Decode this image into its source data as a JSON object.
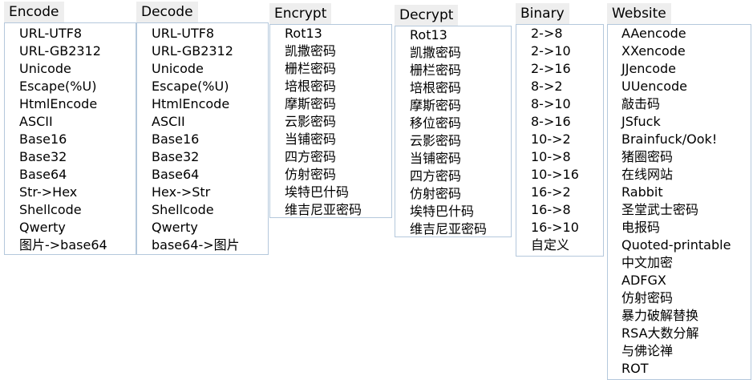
{
  "menus": {
    "encode": {
      "title": "Encode",
      "items": [
        "URL-UTF8",
        "URL-GB2312",
        "Unicode",
        "Escape(%U)",
        "HtmlEncode",
        "ASCII",
        "Base16",
        "Base32",
        "Base64",
        "Str->Hex",
        "Shellcode",
        "Qwerty",
        "图片->base64"
      ]
    },
    "decode": {
      "title": "Decode",
      "items": [
        "URL-UTF8",
        "URL-GB2312",
        "Unicode",
        "Escape(%U)",
        "HtmlEncode",
        "ASCII",
        "Base16",
        "Base32",
        "Base64",
        "Hex->Str",
        "Shellcode",
        "Qwerty",
        "base64->图片"
      ]
    },
    "encrypt": {
      "title": "Encrypt",
      "items": [
        "Rot13",
        "凯撒密码",
        "栅栏密码",
        "培根密码",
        "摩斯密码",
        "云影密码",
        "当铺密码",
        "四方密码",
        "仿射密码",
        "埃特巴什码",
        "维吉尼亚密码"
      ]
    },
    "decrypt": {
      "title": "Decrypt",
      "items": [
        "Rot13",
        "凯撒密码",
        "栅栏密码",
        "培根密码",
        "摩斯密码",
        "移位密码",
        "云影密码",
        "当铺密码",
        "四方密码",
        "仿射密码",
        "埃特巴什码",
        "维吉尼亚密码"
      ]
    },
    "binary": {
      "title": "Binary",
      "items": [
        "2->8",
        "2->10",
        "2->16",
        "8->2",
        "8->10",
        "8->16",
        "10->2",
        "10->8",
        "10->16",
        "16->2",
        "16->8",
        "16->10",
        "自定义"
      ]
    },
    "website": {
      "title": "Website",
      "items": [
        "AAencode",
        "XXencode",
        "JJencode",
        "UUencode",
        "敲击码",
        "JSfuck",
        "Brainfuck/Ook!",
        "猪圈密码",
        "在线网站",
        "Rabbit",
        "圣堂武士密码",
        "电报码",
        "Quoted-printable",
        "中文加密",
        "ADFGX",
        "仿射密码",
        "暴力破解替换",
        "RSA大数分解",
        "与佛论禅",
        "ROT"
      ]
    }
  },
  "colors": {
    "title_bg": "#eeeeee",
    "panel_border": "#b4c8dc",
    "text": "#000000"
  }
}
